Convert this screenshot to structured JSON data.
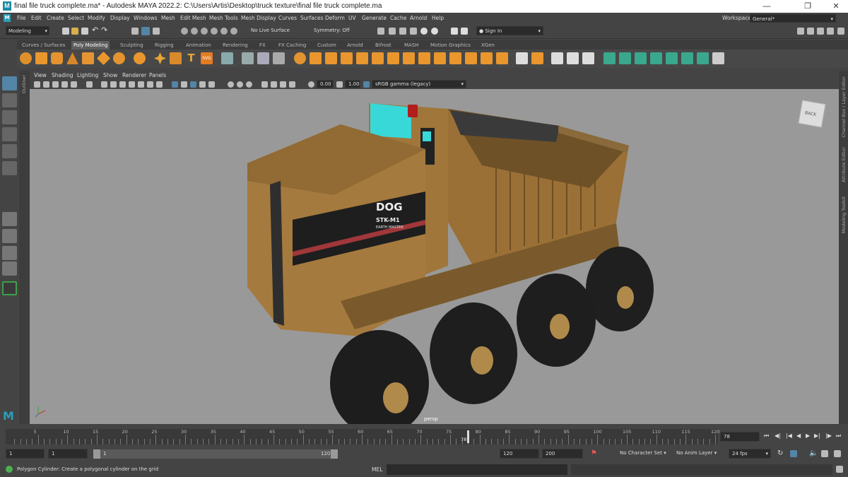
{
  "window": {
    "title": "final file truck complete.ma* - Autodesk MAYA 2022.2: C:\\Users\\Artis\\Desktop\\truck texture\\final file truck complete.ma"
  },
  "menu": [
    "File",
    "Edit",
    "Create",
    "Select",
    "Modify",
    "Display",
    "Windows",
    "Mesh",
    "Edit Mesh",
    "Mesh Tools",
    "Mesh Display",
    "Curves",
    "Surfaces",
    "Deform",
    "UV",
    "Generate",
    "Cache",
    "Arnold",
    "Help"
  ],
  "workspace": {
    "label": "Workspace:",
    "value": "General*"
  },
  "status": {
    "mode": "Modeling",
    "live_surface": "No Live Surface",
    "symmetry": "Symmetry: Off",
    "sign_in": "Sign In"
  },
  "shelf_tabs": [
    "Curves / Surfaces",
    "Poly Modeling",
    "Sculpting",
    "Rigging",
    "Animation",
    "Rendering",
    "FX",
    "FX Caching",
    "Custom",
    "Arnold",
    "Bifrost",
    "MASH",
    "Motion Graphics",
    "XGen"
  ],
  "shelf_active": "Poly Modeling",
  "panel_menu": [
    "View",
    "Shading",
    "Lighting",
    "Show",
    "Renderer",
    "Panels"
  ],
  "panel_tools": {
    "exposure": "0.00",
    "gamma": "1.00",
    "colorspace": "sRGB gamma (legacy)"
  },
  "side_panels": {
    "outliner": "Outliner",
    "right": [
      "Channel Box / Layer Editor",
      "Attribute Editor",
      "Modeling Toolkit"
    ]
  },
  "viewport": {
    "camera": "persp",
    "viewcube": "BACK",
    "truck_decal": {
      "brand": "DOG",
      "model": "STK-M1",
      "sub": "EARTH MASTER"
    }
  },
  "timeline": {
    "ticks": [
      "5",
      "10",
      "15",
      "20",
      "25",
      "30",
      "35",
      "40",
      "45",
      "50",
      "55",
      "60",
      "65",
      "70",
      "75",
      "80",
      "85",
      "90",
      "95",
      "100",
      "105",
      "110",
      "115",
      "120"
    ],
    "current_frame": "78",
    "current_field": "78"
  },
  "range": {
    "start": "1",
    "playback_start": "1",
    "slider_start": "1",
    "slider_end": "120",
    "playback_end": "120",
    "end": "200",
    "character_set": "No Character Set",
    "anim_layer": "No Anim Layer",
    "fps": "24 fps"
  },
  "help_line": {
    "message": "Polygon Cylinder: Create a polygonal cylinder on the grid",
    "script_lang": "MEL"
  },
  "colors": {
    "accent": "#5285a6",
    "truck_body": "#a87d3e",
    "viewport_bg": "#999999",
    "cyan_window": "#38d8d8"
  }
}
